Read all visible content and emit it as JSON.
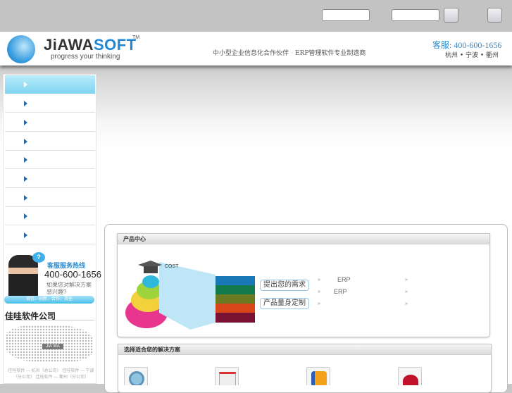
{
  "top": {
    "input1": "",
    "input2": ""
  },
  "header": {
    "logo_main": "JiAWA",
    "logo_accent": "SOFT",
    "trademark": "TM",
    "slogan": "progress your thinking",
    "tagline": "中小型企业信息化合作伙伴　ERP管理软件专业制造商",
    "hotline": "客服: 400-600-1656",
    "cities": "杭州 • 宁波 • 衢州"
  },
  "sidebar": {
    "item_count": 9,
    "active_index": 0
  },
  "service": {
    "bubble": "?",
    "title": "客服服务热线",
    "phone": "400-600-1656",
    "note": "如果您对解决方案感兴趣?",
    "bar": "诚信、创新、合作、责任"
  },
  "company": {
    "title": "佳哇软件公司",
    "map_label": "JIA WA",
    "branches": "佳哇软件 — 杭州（总公司） 佳哇软件 — 宁波（分公司） 佳哇软件 — 衢州（分公司）"
  },
  "products": {
    "title": "产品中心",
    "pyramid_label": "COST",
    "btn_need": "提出您的需求",
    "btn_custom": "产品量身定制",
    "raquo": "»",
    "erp1": "ERP",
    "erp2": "ERP"
  },
  "solutions": {
    "title": "选择适合您的解决方案"
  }
}
